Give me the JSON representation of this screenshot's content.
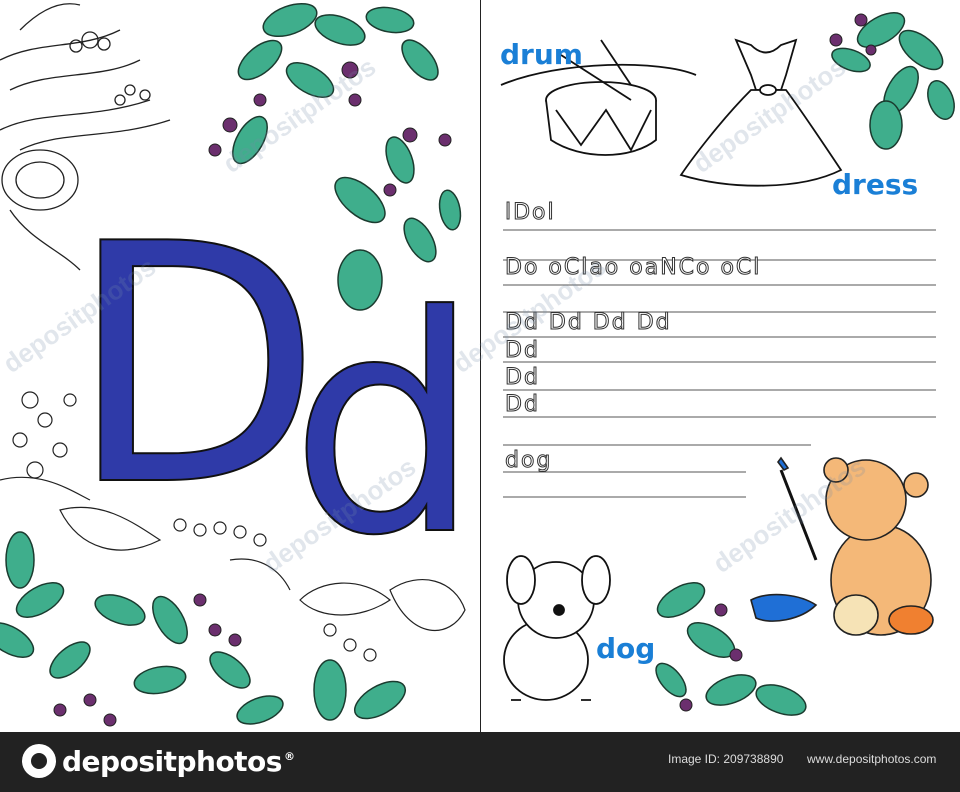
{
  "left_page": {
    "big_letter_upper": "D",
    "big_letter_lower": "d",
    "letter_color": "#2f3aa8"
  },
  "right_page": {
    "words": {
      "drum": "drum",
      "dress": "dress",
      "dog": "dog"
    },
    "trace_rows": {
      "row1": "lDol",
      "row2": "Do oClao oaNCo oCl",
      "row3": "Dd Dd Dd Dd",
      "row4": "Dd",
      "row5": "Dd",
      "row6": "Dd",
      "row7": "dog"
    },
    "word_color": "#1a7fd6"
  },
  "watermark": {
    "text": "depositphotos"
  },
  "footer": {
    "brand": "depositphotos",
    "brand_sup": "®",
    "image_id": "Image ID: 209738890",
    "site": "www.depositphotos.com"
  },
  "colors": {
    "leaf_green": "#3fae8c",
    "berry_purple": "#6b2f6e",
    "bear_orange": "#f4b878",
    "paint_blue": "#1f6fd6"
  }
}
